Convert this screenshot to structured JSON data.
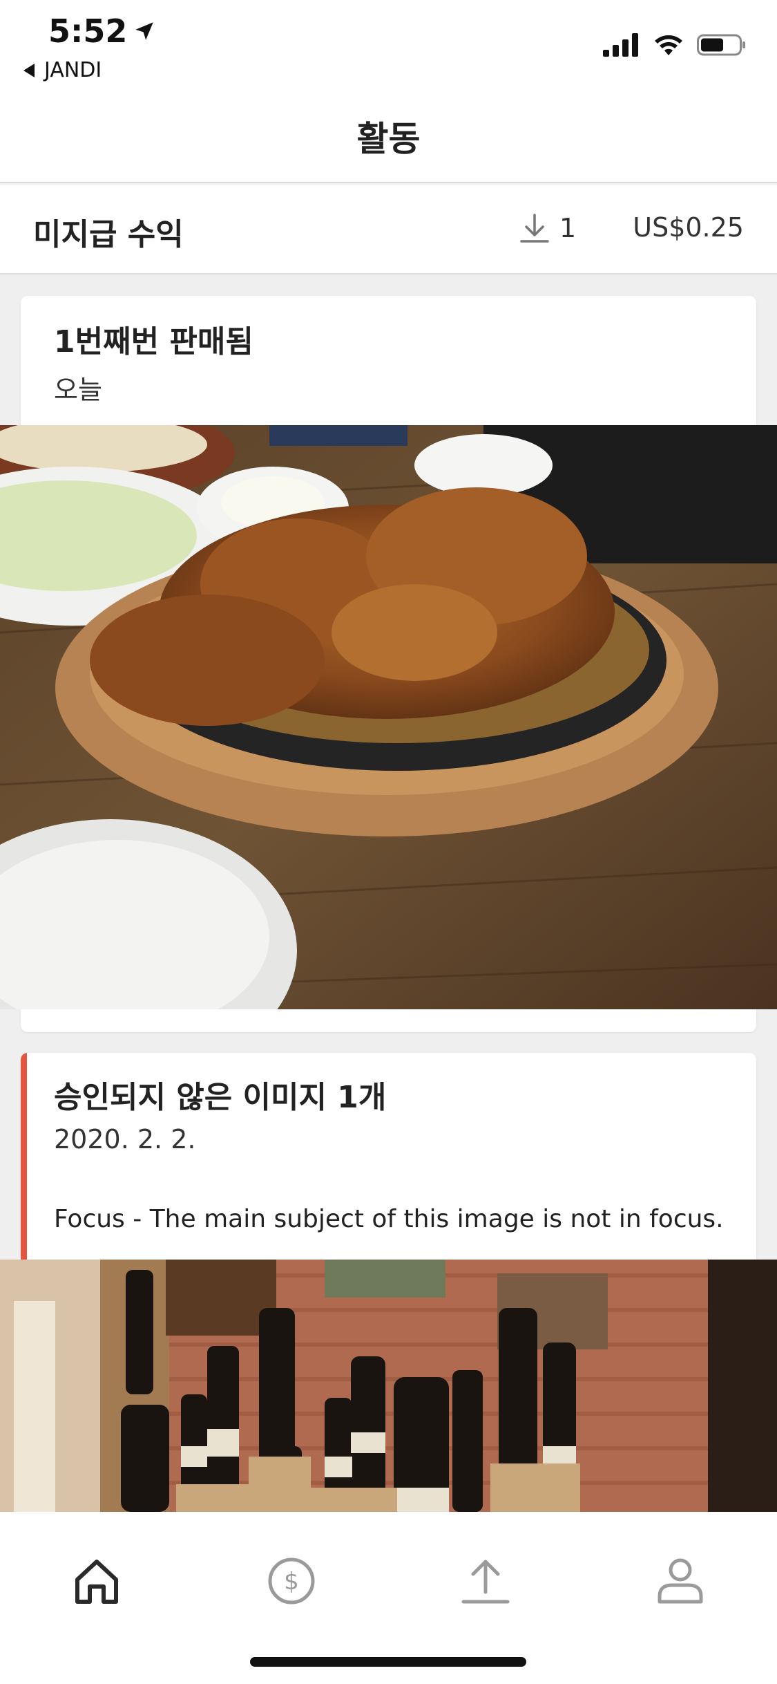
{
  "status_bar": {
    "time": "5:52",
    "back_app": "JANDI"
  },
  "header": {
    "title": "활동"
  },
  "earnings": {
    "label": "미지급 수익",
    "download_count": "1",
    "amount": "US$0.25"
  },
  "cards": [
    {
      "title": "1번째번 판매됨",
      "date": "오늘"
    },
    {
      "title": "승인되지 않은 이미지 1개",
      "date": "2020. 2. 2.",
      "reason": "Focus - The main subject of this image is not in focus."
    }
  ],
  "colors": {
    "accent_reject": "#e3553f",
    "tab_active": "#2a2a2a",
    "tab_inactive": "#9a9a9a"
  },
  "tabs": [
    {
      "icon": "home-icon",
      "active": true
    },
    {
      "icon": "dollar-icon",
      "active": false
    },
    {
      "icon": "upload-icon",
      "active": false
    },
    {
      "icon": "profile-icon",
      "active": false
    }
  ]
}
